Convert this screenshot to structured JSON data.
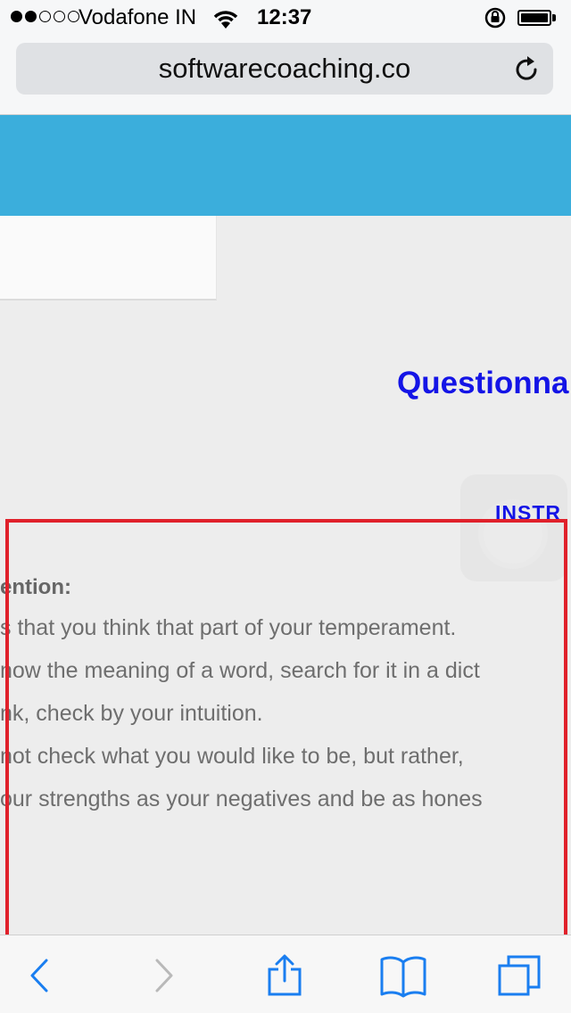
{
  "status_bar": {
    "carrier": "Vodafone IN",
    "time": "12:37",
    "signal_bars_filled": 2,
    "signal_bars_total": 5,
    "battery_level": 1.0
  },
  "browser": {
    "url": "softwarecoaching.co"
  },
  "page": {
    "heading": "Questionna",
    "instructions_label": "INSTR",
    "attention_label": "ention:",
    "bullets": [
      "s that you think that part of your temperament.",
      "now the meaning of a word, search for it in a dict",
      "nk, check by your intuition.",
      "not check what you would like to be, but rather,",
      "our strengths as your negatives and be as hones"
    ]
  },
  "colors": {
    "banner": "#3baedc",
    "heading": "#1414e6",
    "highlight_frame": "#e0212b",
    "ios_blue": "#1a7ef0"
  },
  "toolbar_icons": [
    "back-icon",
    "forward-icon",
    "share-icon",
    "bookmarks-icon",
    "tabs-icon"
  ]
}
